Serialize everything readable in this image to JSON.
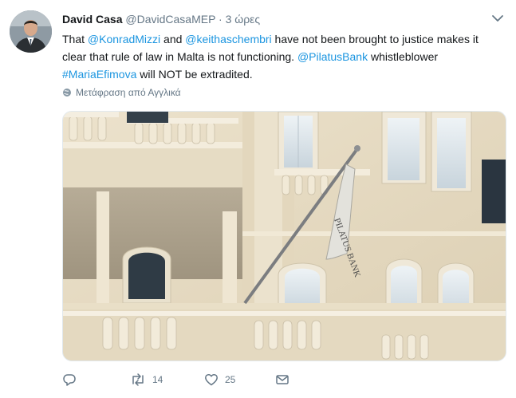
{
  "tweet": {
    "author_name": "David Casa",
    "author_handle": "@DavidCasaMEP",
    "separator": "·",
    "timestamp": "3 ώρες",
    "text": {
      "t1": "That ",
      "m1": "@KonradMizzi",
      "t2": " and ",
      "m2": "@keithaschembri",
      "t3": " have not been brought to justice makes it clear that rule of law in Malta is not functioning. ",
      "m3": "@PilatusBank",
      "t4": " whistleblower ",
      "h1": "#MariaEfimova",
      "t5": " will NOT be extradited."
    },
    "translate_label": "Μετάφραση από Αγγλικά",
    "image_flag_text": "PILATUS BANK",
    "actions": {
      "reply_count": "",
      "retweet_count": "14",
      "like_count": "25"
    },
    "colors": {
      "link": "#1b95e0",
      "muted": "#657786",
      "text": "#14171a"
    }
  }
}
